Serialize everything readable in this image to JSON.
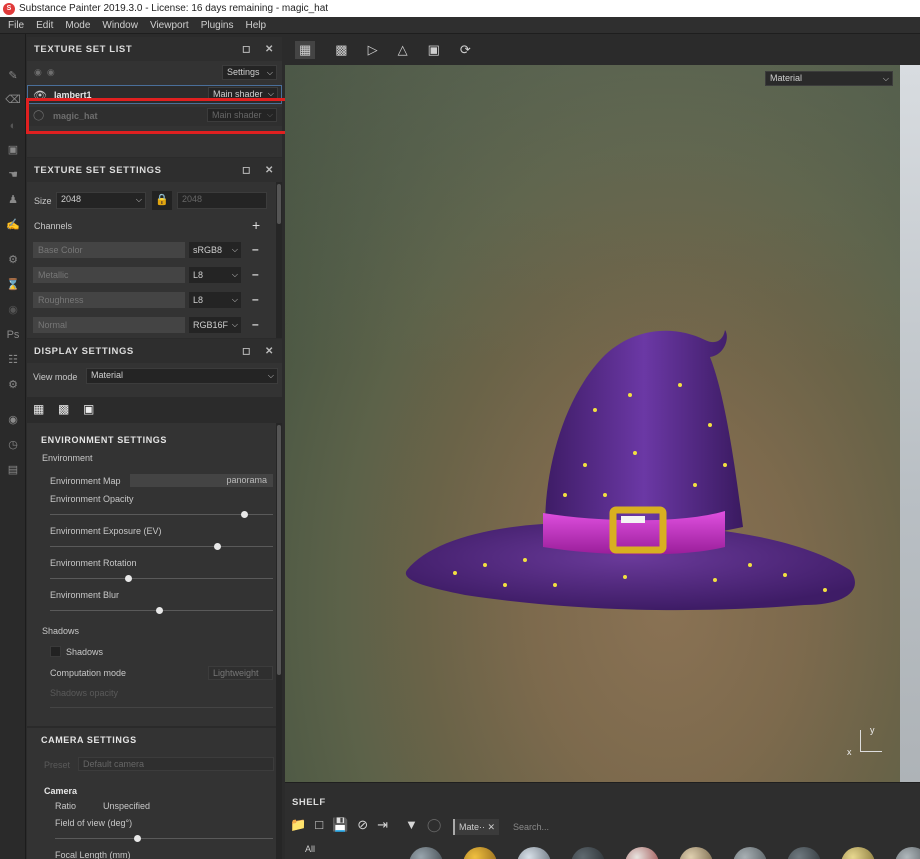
{
  "window": {
    "title": "Substance Painter 2019.3.0 - License: 16 days remaining - magic_hat"
  },
  "menu": [
    "File",
    "Edit",
    "Mode",
    "Window",
    "Viewport",
    "Plugins",
    "Help"
  ],
  "texture_set_list": {
    "title": "TEXTURE SET LIST",
    "settings_label": "Settings",
    "rows": [
      {
        "name": "lambert1",
        "shader": "Main shader"
      },
      {
        "name": "magic_hat",
        "shader": "Main shader"
      }
    ]
  },
  "texture_set_settings": {
    "title": "TEXTURE SET SETTINGS",
    "size_label": "Size",
    "size_value": "2048",
    "size_locked_value": "2048",
    "channels_label": "Channels",
    "channels": [
      {
        "name": "Base Color",
        "format": "sRGB8"
      },
      {
        "name": "Metallic",
        "format": "L8"
      },
      {
        "name": "Roughness",
        "format": "L8"
      },
      {
        "name": "Normal",
        "format": "RGB16F"
      }
    ]
  },
  "display_settings": {
    "title": "DISPLAY SETTINGS",
    "view_mode_label": "View mode",
    "view_mode_value": "Material",
    "environment": {
      "section_title": "ENVIRONMENT SETTINGS",
      "group_label": "Environment",
      "map_label": "Environment Map",
      "map_value": "panorama",
      "opacity_label": "Environment Opacity",
      "opacity_value": 0.87,
      "exposure_label": "Environment Exposure (EV)",
      "exposure_value": 0.75,
      "rotation_label": "Environment Rotation",
      "rotation_value": 0.35,
      "blur_label": "Environment Blur",
      "blur_value": 0.49
    },
    "shadows": {
      "group_label": "Shadows",
      "checkbox_label": "Shadows",
      "computation_label": "Computation mode",
      "computation_value": "Lightweight",
      "opacity_label": "Shadows opacity"
    },
    "camera": {
      "section_title": "CAMERA SETTINGS",
      "preset_label": "Preset",
      "preset_value": "Default camera",
      "group_label": "Camera",
      "ratio_label": "Ratio",
      "ratio_value": "Unspecified",
      "fov_label": "Field of view (deg°)",
      "fov_value": 0.38,
      "focal_label": "Focal Length (mm)"
    }
  },
  "viewport": {
    "mode_dropdown": "Material",
    "axis_y": "y",
    "axis_x": "x"
  },
  "shelf": {
    "title": "SHELF",
    "tag_label": "Mate··",
    "search_placeholder": "Search...",
    "category_all": "All"
  },
  "colors": {
    "accent_highlight": "#e02020",
    "hat_purple": "#5a2a8a",
    "band_magenta": "#c030c0",
    "buckle_gold": "#d8b020"
  }
}
